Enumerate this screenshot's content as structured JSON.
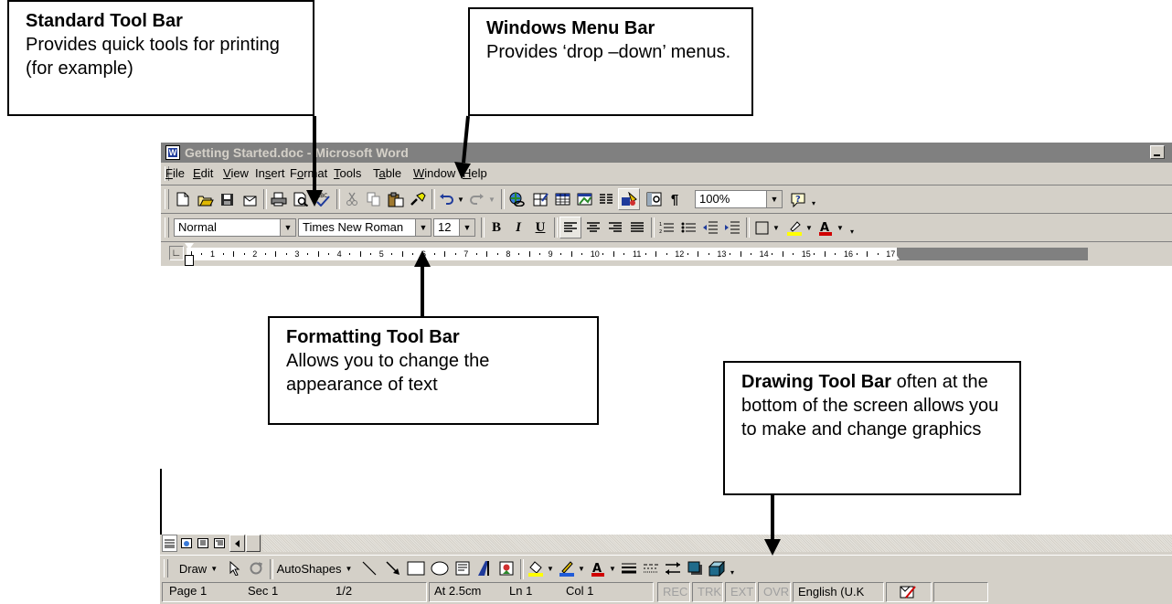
{
  "callouts": {
    "standard": {
      "title": "Standard Tool Bar",
      "text": "Provides quick tools for printing (for example)"
    },
    "windows_menu": {
      "title": "Windows Menu Bar",
      "text": "Provides ‘drop –down’ menus."
    },
    "formatting": {
      "title": "Formatting Tool Bar",
      "text": "Allows you to change the appearance of text"
    },
    "drawing": {
      "title": "Drawing Tool Bar",
      "text": " often at the bottom of the screen allows you to make and change graphics"
    }
  },
  "window": {
    "title": "Getting Started.doc - Microsoft Word",
    "title_bg": "#808080",
    "face": "#d4d0c8"
  },
  "menu": [
    {
      "pre": "",
      "u": "F",
      "post": "ile"
    },
    {
      "pre": "",
      "u": "E",
      "post": "dit"
    },
    {
      "pre": "",
      "u": "V",
      "post": "iew"
    },
    {
      "pre": "In",
      "u": "s",
      "post": "ert"
    },
    {
      "pre": "F",
      "u": "o",
      "post": "rmat"
    },
    {
      "pre": "",
      "u": "T",
      "post": "ools"
    },
    {
      "pre": "T",
      "u": "a",
      "post": "ble"
    },
    {
      "pre": "",
      "u": "W",
      "post": "indow"
    },
    {
      "pre": "",
      "u": "H",
      "post": "elp"
    }
  ],
  "standard_toolbar": {
    "zoom": "100%"
  },
  "formatting_toolbar": {
    "style": "Normal",
    "font": "Times New Roman",
    "size": "12",
    "bold": "B",
    "italic": "I",
    "underline": "U"
  },
  "ruler": {
    "labels": [
      "1",
      "2",
      "3",
      "4",
      "5",
      "6",
      "7",
      "8",
      "9",
      "10",
      "11",
      "12",
      "13",
      "14",
      "15",
      "16",
      "17"
    ]
  },
  "drawing_toolbar": {
    "draw": "Draw",
    "autoshapes": "AutoShapes"
  },
  "status_bar": {
    "page": "Page 1",
    "sec": "Sec 1",
    "pages": "1/2",
    "at": "At 2.5cm",
    "ln": "Ln 1",
    "col": "Col 1",
    "rec": "REC",
    "trk": "TRK",
    "ext": "EXT",
    "ovr": "OVR",
    "lang": "English (U.K"
  }
}
